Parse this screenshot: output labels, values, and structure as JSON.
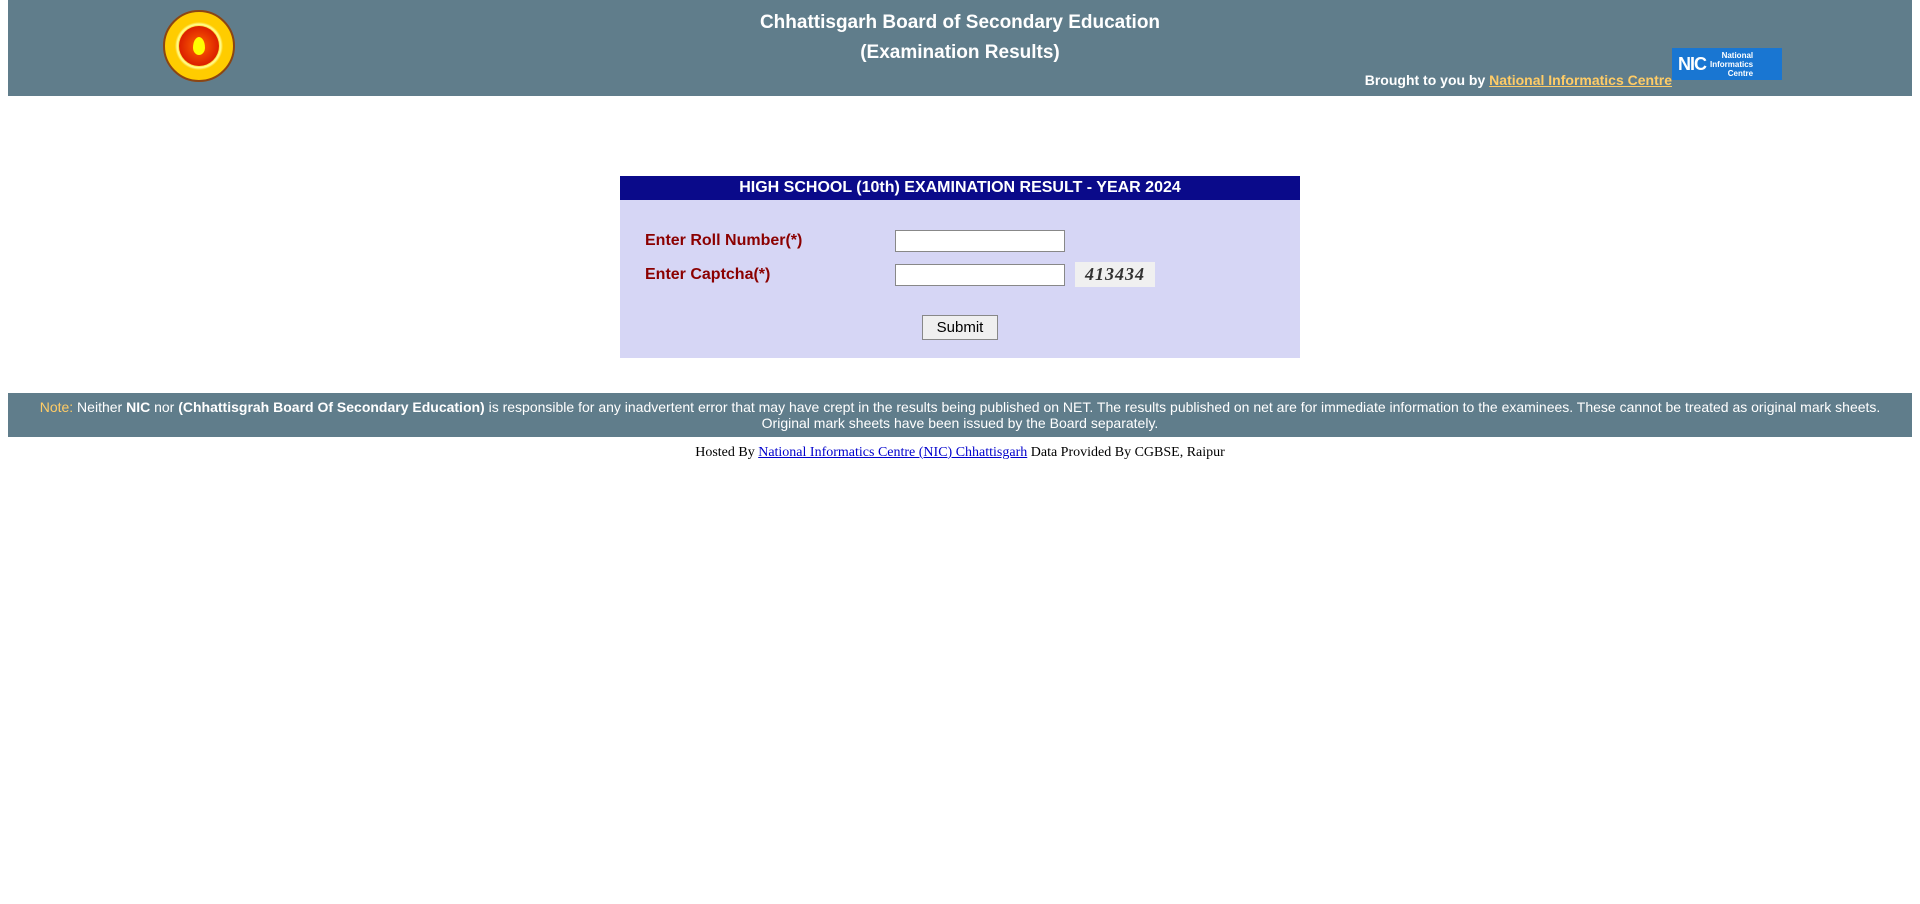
{
  "header": {
    "title": "Chhattisgarh Board of Secondary Education",
    "subtitle": "(Examination Results)",
    "brought_by_prefix": "Brought to you by ",
    "brought_by_link": "National Informatics Centre",
    "nic_big": "NIC",
    "nic_small_l1": "National",
    "nic_small_l2": "Informatics",
    "nic_small_l3": "Centre"
  },
  "form": {
    "header": "HIGH SCHOOL (10th) EXAMINATION RESULT - YEAR 2024",
    "roll_label": "Enter Roll Number(*)",
    "captcha_label": "Enter Captcha(*)",
    "captcha_value": "413434",
    "submit_label": "Submit",
    "roll_value": "",
    "captcha_input_value": ""
  },
  "note": {
    "prefix": "Note:",
    "text1": " Neither ",
    "bold1": "NIC",
    "text2": " nor ",
    "bold2": "(Chhattisgrah Board Of Secondary Education)",
    "text3": " is responsible for any inadvertent error that may have crept in the results being published on NET. The results published on net are for immediate information to the examinees. These cannot be treated as original mark sheets. Original mark sheets have been issued by the Board separately."
  },
  "footer": {
    "hosted_prefix": "Hosted By ",
    "hosted_link": "National Informatics Centre (NIC) Chhattisgarh",
    "data_provided": "  Data Provided By CGBSE, Raipur"
  }
}
